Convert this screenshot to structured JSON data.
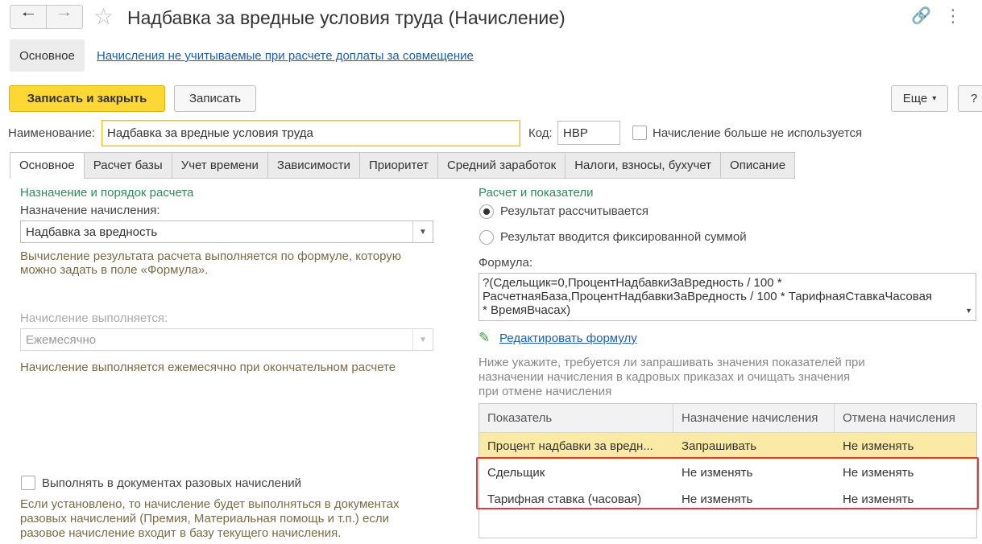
{
  "window": {
    "title": "Надбавка за вредные условия труда (Начисление)",
    "back_icon": "arrow-left-icon",
    "forward_icon": "arrow-right-icon",
    "favorite_icon": "star-icon",
    "link_icon": "link-icon",
    "menu_icon": "kebab-menu-icon"
  },
  "subpages": {
    "active": "Основное",
    "link": "Начисления не учитываемые при расчете доплаты за совмещение"
  },
  "toolbar": {
    "save_close": "Записать и закрыть",
    "save": "Записать",
    "more": "Еще",
    "more_arrow": "▾",
    "help": "?"
  },
  "form": {
    "name_label": "Наименование:",
    "name_value": "Надбавка за вредные условия труда",
    "code_label": "Код:",
    "code_value": "НВР",
    "not_used_label": "Начисление больше не используется"
  },
  "tabs": [
    "Основное",
    "Расчет базы",
    "Учет времени",
    "Зависимости",
    "Приоритет",
    "Средний заработок",
    "Налоги, взносы, бухучет",
    "Описание"
  ],
  "left": {
    "section_title": "Назначение и порядок расчета",
    "purpose_label": "Назначение начисления:",
    "purpose_value": "Надбавка за вредность",
    "purpose_hint_1": "Вычисление результата расчета выполняется по формуле, которую",
    "purpose_hint_2": "можно задать в поле «Формула».",
    "period_label": "Начисление выполняется:",
    "period_value": "Ежемесячно",
    "period_hint": "Начисление выполняется ежемесячно при окончательном расчете",
    "onetime_label": "Выполнять в документах разовых начислений",
    "onetime_hint_1": "Если установлено, то начисление будет выполняться в документах",
    "onetime_hint_2": "разовых начислений (Премия, Материальная помощь и т.п.) если",
    "onetime_hint_3": "разовое начисление входит в базу текущего начисления."
  },
  "right": {
    "section_title": "Расчет и показатели",
    "radio_calc": "Результат рассчитывается",
    "radio_fixed": "Результат вводится фиксированной суммой",
    "formula_label": "Формула:",
    "formula_line_1": "?(Сдельщик=0,ПроцентНадбавкиЗаВредность / 100 *",
    "formula_line_2": "РасчетнаяБаза,ПроцентНадбавкиЗаВредность / 100 * ТарифнаяСтавкаЧасовая",
    "formula_line_3": "* ВремяВчасах)",
    "edit_formula": "Редактировать формулу",
    "edit_icon": "pencil-icon",
    "indicators_hint_1": "Ниже укажите, требуется ли запрашивать значения показателей при",
    "indicators_hint_2": "назначении начисления в кадровых приказах и очищать значения",
    "indicators_hint_3": "при отмене начисления"
  },
  "grid": {
    "columns": [
      "Показатель",
      "Назначение начисления",
      "Отмена начисления"
    ],
    "rows": [
      [
        "Процент надбавки за вредн...",
        "Запрашивать",
        "Не изменять"
      ],
      [
        "Сдельщик",
        "Не изменять",
        "Не изменять"
      ],
      [
        "Тарифная ставка (часовая)",
        "Не изменять",
        "Не изменять"
      ]
    ]
  }
}
